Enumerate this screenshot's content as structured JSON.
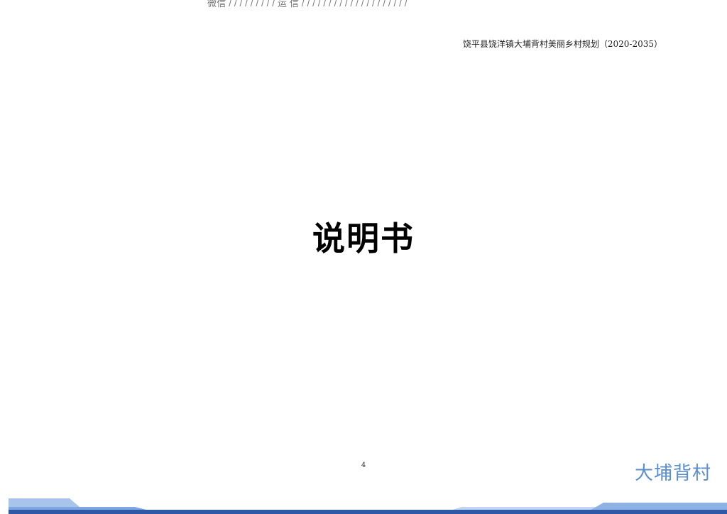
{
  "watermark": {
    "text": "微信 / / / / / / / / / 运 信 / / / / / / / / / / / / / / / / / / / /"
  },
  "header": {
    "doc_title": "饶平县饶洋镇大埔背村美丽乡村规划（2020-2035）"
  },
  "main": {
    "title": "说明书"
  },
  "footer": {
    "page_number": "4",
    "logo_text": "大埔背村"
  },
  "colors": {
    "band_dark": "#2f58a6",
    "band_light": "#a9c4ea",
    "band_mid": "#7ea6df",
    "logo_text": "#5b8ed0"
  }
}
